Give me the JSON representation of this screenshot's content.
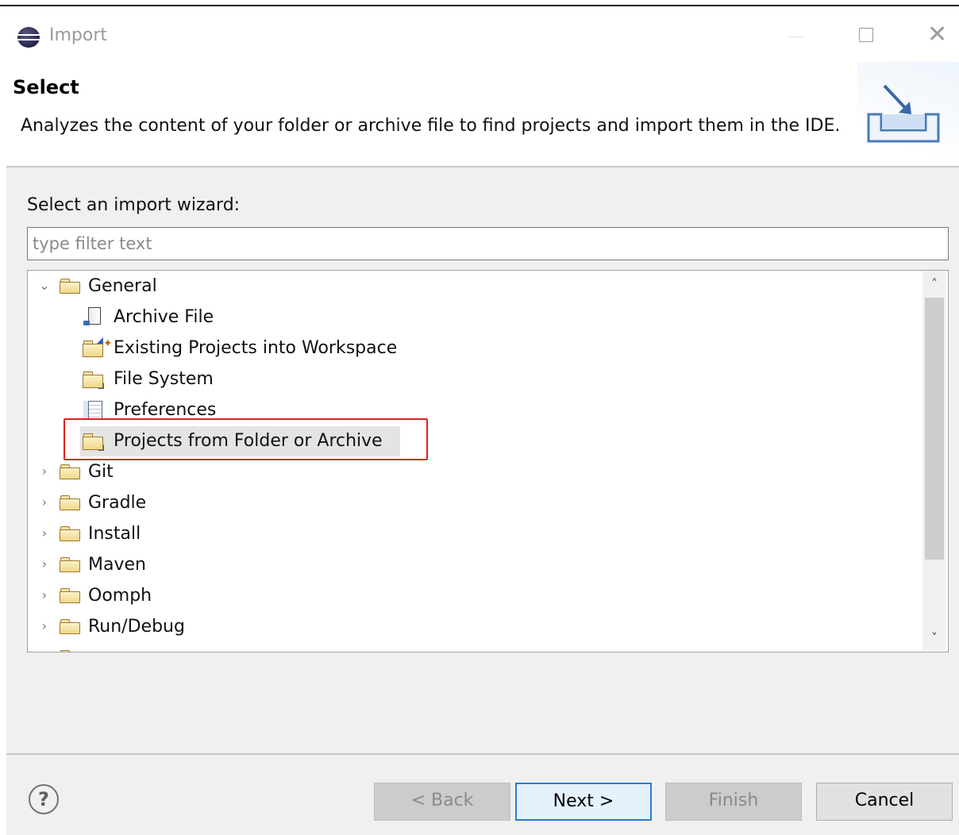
{
  "window": {
    "title": "Import",
    "close_glyph": "✕"
  },
  "header": {
    "title": "Select",
    "description": "Analyzes the content of your folder or archive file to find projects and import them in the IDE."
  },
  "wizard": {
    "label": "Select an import wizard:",
    "filter_placeholder": "type filter text",
    "filter_value": ""
  },
  "tree": {
    "general": "General",
    "children": [
      "Archive File",
      "Existing Projects into Workspace",
      "File System",
      "Preferences",
      "Projects from Folder or Archive"
    ],
    "selected": "Projects from Folder or Archive",
    "categories": [
      "Git",
      "Gradle",
      "Install",
      "Maven",
      "Oomph",
      "Run/Debug"
    ],
    "expanded_glyph": "⌄",
    "collapsed_glyph": "›"
  },
  "scrollbar": {
    "up_glyph": "˄",
    "down_glyph": "˅"
  },
  "footer": {
    "help_glyph": "?",
    "back_label": "< Back",
    "next_label": "Next >",
    "finish_label": "Finish",
    "cancel_label": "Cancel"
  },
  "colors": {
    "highlight": "#e02020",
    "default_button_border": "#2a7ad5"
  }
}
